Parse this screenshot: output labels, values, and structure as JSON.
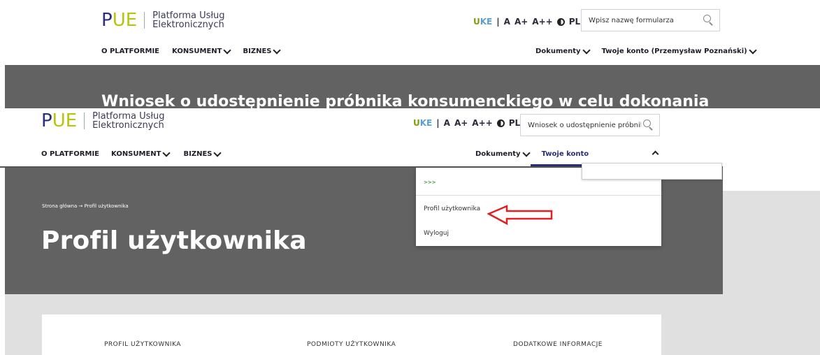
{
  "logo": {
    "mark_p": "P",
    "mark_ue": "UE",
    "line1": "Platforma Usług",
    "line2": "Elektronicznych"
  },
  "accessibility": {
    "uke_u": "U",
    "uke_ke": "KE",
    "sep": "|",
    "font_a": "A",
    "font_a_plus": "A+",
    "font_a_plus_plus": "A++",
    "lang": "PL"
  },
  "back": {
    "search_placeholder": "Wpisz nazwę formularza",
    "nav": {
      "about": "O PLATFORMIE",
      "consumer": "KONSUMENT",
      "business": "BIZNES",
      "documents": "Dokumenty",
      "account": "Twoje konto (Przemysław Poznański)"
    },
    "hero_title": "Wniosek o udostępnienie próbnika konsumenckiego w celu dokonania"
  },
  "front": {
    "search_value": "Wniosek o udostępnienie próbnika kons",
    "nav": {
      "about": "O PLATFORMIE",
      "consumer": "KONSUMENT",
      "business": "BIZNES",
      "documents": "Dokumenty",
      "account": "Twoje konto"
    },
    "breadcrumb": "Strona główna → Profil użytkownika",
    "page_title": "Profil użytkownika",
    "dropdown": {
      "marker": ">>>",
      "profile": "Profil użytkownika",
      "logout": "Wyloguj"
    },
    "sections": [
      "PROFIL UŻYTKOWNIKA",
      "PODMIOTY UŻYTKOWNIKA",
      "DODATKOWE INFORMACJE"
    ]
  },
  "colors": {
    "brand_blue": "#2b2f7a",
    "brand_lime": "#b8c40a",
    "hero_grey": "#626262",
    "annotation_red": "#e02020"
  }
}
